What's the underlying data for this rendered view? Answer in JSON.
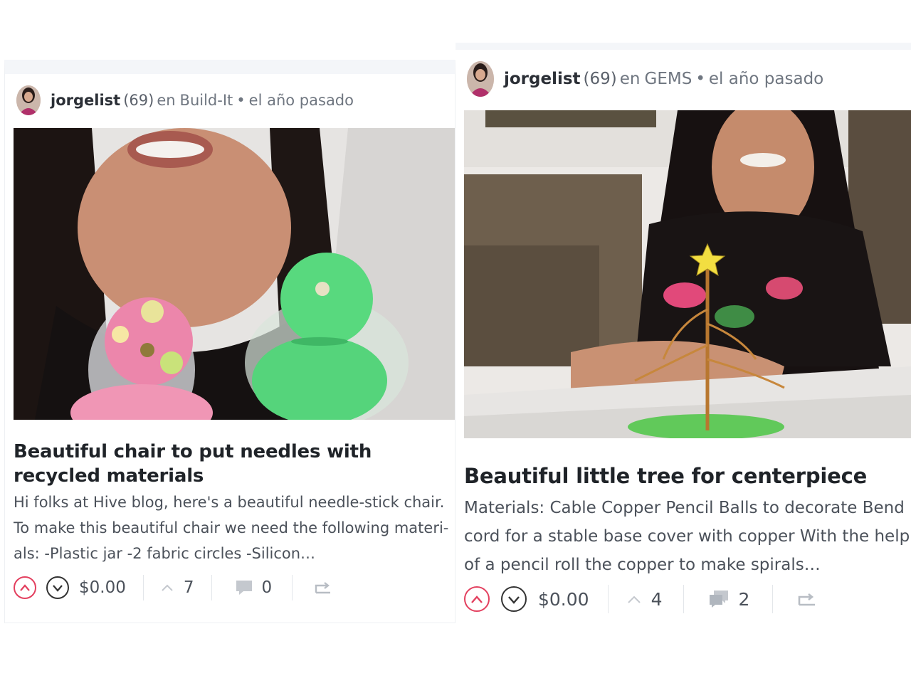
{
  "cards": [
    {
      "author": "jorgelist",
      "reputation": "(69)",
      "community_prefix": "en",
      "community": "Build-It",
      "separator": "•",
      "time_ago": "el año pasado",
      "title": "Beautiful chair to put needles with recycled materials",
      "summary": "Hi folks at Hive blog, here's a beautiful needle-stick chair. To make this beautiful chair we need the following materi-als: -Plastic jar -2 fabric circles -Silicon…",
      "payout": "$0.00",
      "votes": "7",
      "comments": "0",
      "icons": {
        "upvote": "upvote-circle-icon",
        "downvote": "downvote-circle-icon",
        "votes": "chevron-up-icon",
        "comments": "comment-bubble-icon",
        "reblog": "reblog-icon"
      }
    },
    {
      "author": "jorgelist",
      "reputation": "(69)",
      "community_prefix": "en",
      "community": "GEMS",
      "separator": "•",
      "time_ago": "el año pasado",
      "title": "Beautiful little tree for centerpiece",
      "summary": "Materials: Cable Copper Pencil Balls to decorate Bend cord for a stable base cover with copper With the help of a pencil roll the copper to make spirals…",
      "payout": "$0.00",
      "votes": "4",
      "comments": "2",
      "icons": {
        "upvote": "upvote-circle-icon",
        "downvote": "downvote-circle-icon",
        "votes": "chevron-up-icon",
        "comments": "comments-bubbles-icon",
        "reblog": "reblog-icon"
      }
    }
  ],
  "colors": {
    "upvote": "#e3405f",
    "text": "#1f2328",
    "muted": "#9aa0a8"
  }
}
